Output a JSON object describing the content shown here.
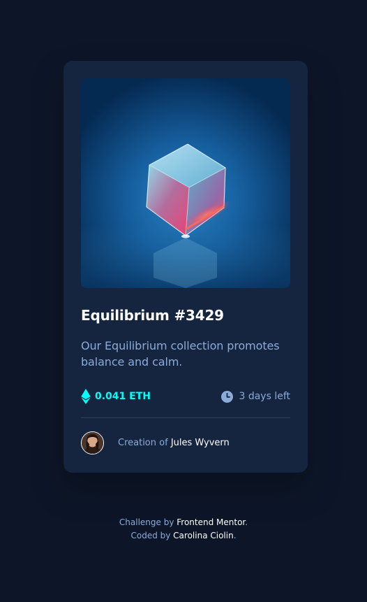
{
  "card": {
    "image_alt": "Equilibrium crystal cube",
    "title": "Equilibrium #3429",
    "description": "Our Equilibrium collection promotes balance and calm.",
    "price": "0.041 ETH",
    "time_left": "3 days left",
    "creator_prefix": "Creation of ",
    "creator_name": "Jules Wyvern"
  },
  "footer": {
    "line1_prefix": "Challenge by ",
    "line1_link": "Frontend Mentor",
    "line1_suffix": ".",
    "line2_prefix": "Coded by ",
    "line2_link": "Carolina Ciolin",
    "line2_suffix": "."
  },
  "icons": {
    "price": "ethereum-icon",
    "time": "clock-icon"
  },
  "colors": {
    "page_bg": "#0d1628",
    "card_bg": "#15243f",
    "accent": "#00fff8",
    "muted_text": "#8bacd9",
    "white": "#ffffff",
    "divider": "#2e405f"
  }
}
